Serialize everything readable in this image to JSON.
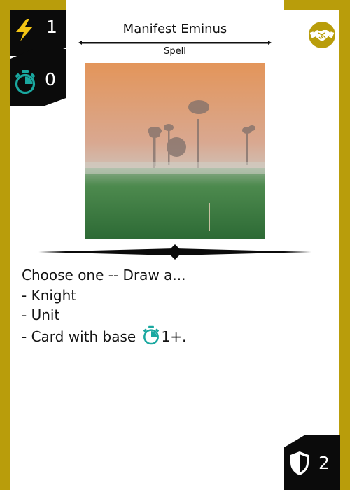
{
  "card": {
    "name": "Manifest Eminus",
    "type": "Spell",
    "cost": "1",
    "time": "0",
    "defense": "2",
    "rules": {
      "line1": "Choose one -- Draw a...",
      "line2": "- Knight",
      "line3": "- Unit",
      "line4_before": "- Card with base",
      "line4_after": "1+."
    }
  },
  "icons": {
    "cost": "lightning-icon",
    "time": "stopwatch-icon",
    "defense": "shield-icon",
    "faction": "handshake-icon"
  },
  "colors": {
    "frame": "#b99d0b",
    "stat_box": "#0b0b0b",
    "energy": "#f4c514",
    "time": "#1aa8a0"
  }
}
